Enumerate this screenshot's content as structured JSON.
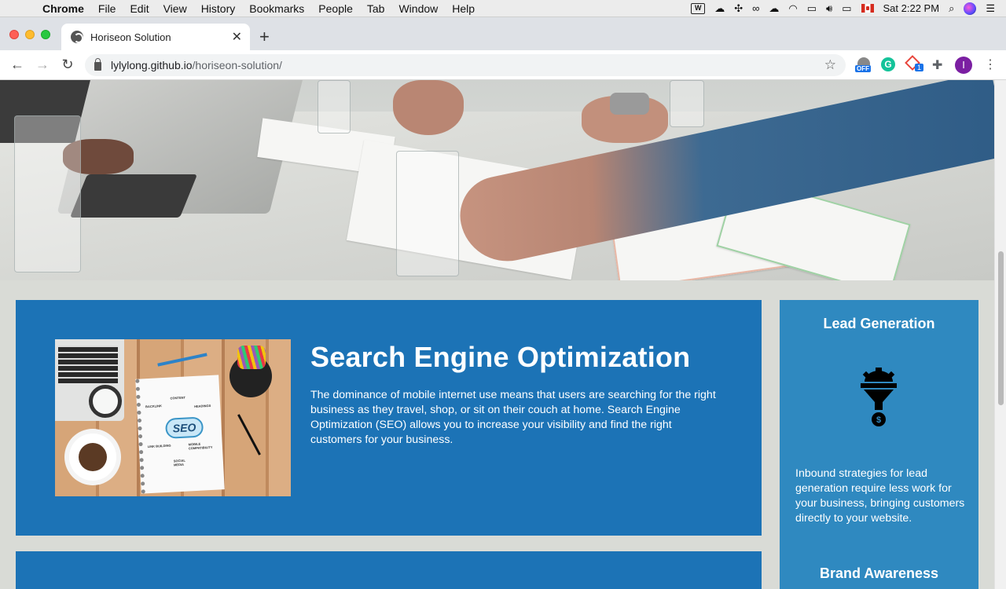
{
  "menubar": {
    "app_name": "Chrome",
    "items": [
      "File",
      "Edit",
      "View",
      "History",
      "Bookmarks",
      "People",
      "Tab",
      "Window",
      "Help"
    ],
    "clock": "Sat 2:22 PM"
  },
  "browser": {
    "tab_title": "Horiseon Solution",
    "url_host": "lylylong.github.io",
    "url_path": "/horiseon-solution/",
    "ext_off_badge": "OFF",
    "ext_grammarly_letter": "G",
    "ext_badge_count": "1",
    "avatar_letter": "I"
  },
  "seo": {
    "title": "Search Engine Optimization",
    "body": "The dominance of mobile internet use means that users are searching for the right business as they travel, shop, or sit on their couch at home. Search Engine Optimization (SEO) allows you to increase your visibility and find the right customers for your business.",
    "image_text": {
      "center": "SEO",
      "content": "CONTENT",
      "backlink": "BACKLINK",
      "headings": "HEADINGS",
      "link_building": "LINK BUILDING",
      "mobile": "MOBILE COMPATIBILITY",
      "social": "SOCIAL MEDIA"
    }
  },
  "aside": {
    "lead_title": "Lead Generation",
    "lead_text": "Inbound strategies for lead generation require less work for your business, bringing customers directly to your website.",
    "brand_title": "Brand Awareness"
  },
  "colors": {
    "card_blue": "#1c73b6",
    "aside_blue": "#2f89c0",
    "page_bg": "#d9dbd6"
  }
}
